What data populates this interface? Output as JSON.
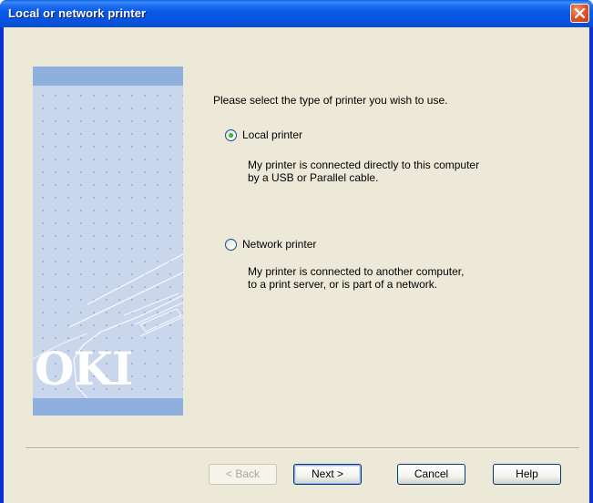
{
  "window": {
    "title": "Local or network printer"
  },
  "side_panel": {
    "brand": "OKI"
  },
  "main": {
    "prompt": "Please select the type of printer you wish to use.",
    "options": [
      {
        "label": "Local printer",
        "selected": true,
        "description_line1": "My printer is connected directly to this computer",
        "description_line2": "by a USB or Parallel cable."
      },
      {
        "label": "Network printer",
        "selected": false,
        "description_line1": "My printer is connected to another computer,",
        "description_line2": "to a print server, or is part of a network."
      }
    ]
  },
  "buttons": {
    "back_label": "< Back",
    "next_label": "Next >",
    "cancel_label": "Cancel",
    "help_label": "Help"
  },
  "colors": {
    "title_bar": "#0859e6",
    "client_bg": "#ece9d8",
    "close_button": "#e2572f",
    "side_panel": "#c9d6ec"
  },
  "icons": {
    "close": "close-x-icon",
    "side_art": "printer-illustration"
  }
}
